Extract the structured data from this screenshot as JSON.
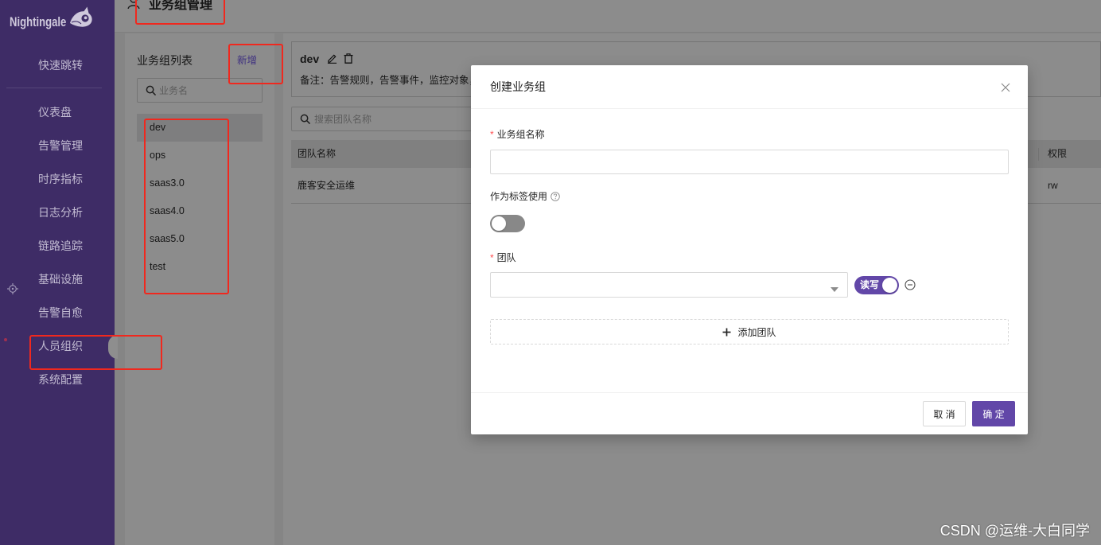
{
  "app": {
    "logo_text": "Nightingale",
    "logo_icon": "bird-logo-icon",
    "page_title": "业务组管理",
    "page_title_icon": "user-icon",
    "watermark": "CSDN @运维-大白同学"
  },
  "colors": {
    "brand": "#6c53b1",
    "primary_button": "#6247a8",
    "sidebar_background": "#3e2c66",
    "annotation_red": "#f0281e",
    "required_mark": "#ff4d4f"
  },
  "sidebar": {
    "items": [
      {
        "label": "快速跳转"
      },
      {
        "label": "仪表盘"
      },
      {
        "label": "告警管理"
      },
      {
        "label": "时序指标"
      },
      {
        "label": "日志分析"
      },
      {
        "label": "链路追踪"
      },
      {
        "label": "基础设施",
        "icon": "crosshair-icon"
      },
      {
        "label": "告警自愈"
      },
      {
        "label": "人员组织",
        "active": true
      },
      {
        "label": "系统配置"
      }
    ]
  },
  "group_list": {
    "title": "业务组列表",
    "add_label": "新增",
    "search": {
      "placeholder": "业务名",
      "value": "",
      "icon": "search-icon"
    },
    "items": [
      {
        "name": "dev",
        "selected": true
      },
      {
        "name": "ops"
      },
      {
        "name": "saas3.0"
      },
      {
        "name": "saas4.0"
      },
      {
        "name": "saas5.0"
      },
      {
        "name": "test"
      }
    ]
  },
  "group_detail": {
    "name": "dev",
    "actions": [
      "edit-icon",
      "delete-icon"
    ],
    "note": "备注：告警规则，告警事件，监控对象，",
    "team_search": {
      "placeholder": "搜索团队名称",
      "value": "",
      "icon": "search-icon"
    },
    "table": {
      "columns": [
        "团队名称",
        "权限"
      ],
      "rows": [
        {
          "team": "鹿客安全运维",
          "permission": "rw"
        }
      ]
    }
  },
  "modal": {
    "title": "创建业务组",
    "close_icon": "close-icon",
    "required_mark": "*",
    "fields": {
      "name": {
        "label": "业务组名称",
        "value": ""
      },
      "as_tag": {
        "label": "作为标签使用",
        "help_icon": "question-circle-icon",
        "enabled": false
      },
      "team": {
        "label": "团队",
        "value": "",
        "dropdown_icon": "caret-down-icon",
        "permission_label": "读写",
        "permission_enabled": true,
        "remove_icon": "minus-circle-icon"
      }
    },
    "add_team": {
      "label": "添加团队",
      "icon": "plus-icon"
    },
    "buttons": {
      "cancel": "取 消",
      "ok": "确 定"
    }
  }
}
